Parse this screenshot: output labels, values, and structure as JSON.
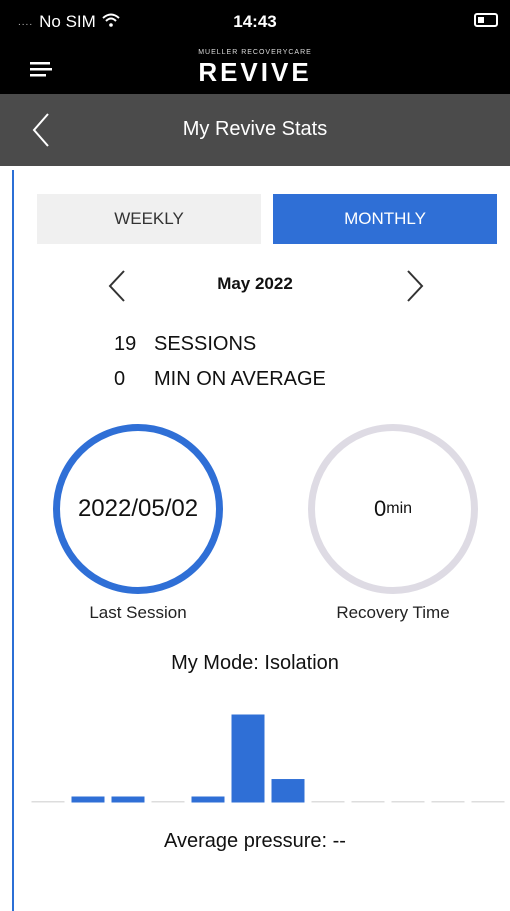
{
  "status_bar": {
    "signal": "....",
    "carrier": "No SIM",
    "time": "14:43"
  },
  "header": {
    "logo_small": "MUELLER RECOVERYCARE",
    "logo_main": "REVIVE"
  },
  "title_bar": {
    "title": "My Revive Stats"
  },
  "period_toggle": {
    "weekly_label": "WEEKLY",
    "monthly_label": "MONTHLY",
    "selected": "MONTHLY"
  },
  "month_nav": {
    "label": "May 2022"
  },
  "stats": {
    "sessions_value": "19",
    "sessions_label": "SESSIONS",
    "average_value": "0",
    "average_label": "MIN ON AVERAGE"
  },
  "last_session": {
    "value": "2022/05/02",
    "caption": "Last Session"
  },
  "recovery": {
    "value": "0",
    "unit": "min",
    "caption": "Recovery Time"
  },
  "mode": {
    "text": "My Mode: Isolation"
  },
  "chart_data": {
    "type": "bar",
    "title": "",
    "xlabel": "",
    "ylabel": "",
    "values": [
      0,
      1,
      1,
      0,
      1,
      15,
      4,
      0,
      0,
      0,
      0,
      0
    ],
    "color": "#2f6fd6",
    "baseline_color": "#dddddd"
  },
  "average_pressure": {
    "text": "Average pressure: --"
  },
  "colors": {
    "accent": "#2f6fd6",
    "header_bg": "#000000",
    "title_bar_bg": "#4b4b4b",
    "inactive_ring": "#dedbe4"
  },
  "icons": {
    "menu": "hamburger-menu-icon",
    "back": "chevron-left-icon",
    "prev": "chevron-left-icon",
    "next": "chevron-right-icon",
    "wifi": "wifi-icon",
    "battery": "battery-icon"
  }
}
